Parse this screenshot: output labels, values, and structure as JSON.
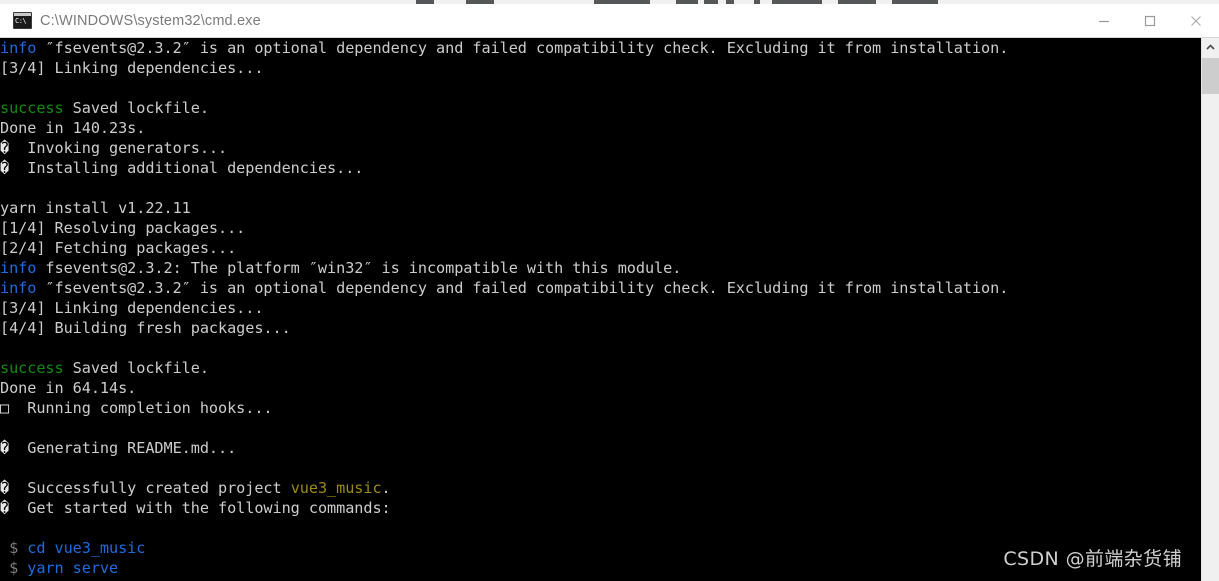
{
  "window": {
    "title": "C:\\WINDOWS\\system32\\cmd.exe",
    "icon_text": "C:\\",
    "controls": {
      "minimize": "Minimize",
      "maximize": "Maximize",
      "close": "Close"
    }
  },
  "watermark": {
    "text": "CSDN @前端杂货铺"
  },
  "scrollbar": {
    "up_arrow": "scroll-up",
    "thumb": "scroll-thumb"
  },
  "colors": {
    "background": "#000000",
    "default_text": "#cccccc",
    "info": "#1d6be0",
    "success": "#108b10",
    "project_name": "#9c8a12",
    "command": "#1d6be0",
    "prompt": "#7c7c7c",
    "titlebar_bg": "#ffffff",
    "titlebar_text": "#7b7b7b",
    "scrollbar_track": "#f0f0f0",
    "scrollbar_thumb": "#cdcdcd"
  },
  "console": {
    "lines": [
      [
        {
          "t": "info",
          "c": "info"
        },
        {
          "t": " ″fsevents@2.3.2″ is an optional dependency and failed compatibility check. Excluding it from installation.",
          "c": "default"
        }
      ],
      [
        {
          "t": "[3/4] Linking dependencies...",
          "c": "default"
        }
      ],
      [],
      [
        {
          "t": "success",
          "c": "success"
        },
        {
          "t": " Saved lockfile.",
          "c": "default"
        }
      ],
      [
        {
          "t": "Done in 140.23s.",
          "c": "default"
        }
      ],
      [
        {
          "t": "�",
          "c": "rep"
        },
        {
          "t": "  Invoking generators...",
          "c": "default"
        }
      ],
      [
        {
          "t": "�",
          "c": "rep"
        },
        {
          "t": "  Installing additional dependencies...",
          "c": "default"
        }
      ],
      [],
      [
        {
          "t": "yarn install v1.22.11",
          "c": "default"
        }
      ],
      [
        {
          "t": "[1/4] Resolving packages...",
          "c": "default"
        }
      ],
      [
        {
          "t": "[2/4] Fetching packages...",
          "c": "default"
        }
      ],
      [
        {
          "t": "info",
          "c": "info"
        },
        {
          "t": " fsevents@2.3.2: The platform ″win32″ is incompatible with this module.",
          "c": "default"
        }
      ],
      [
        {
          "t": "info",
          "c": "info"
        },
        {
          "t": " ″fsevents@2.3.2″ is an optional dependency and failed compatibility check. Excluding it from installation.",
          "c": "default"
        }
      ],
      [
        {
          "t": "[3/4] Linking dependencies...",
          "c": "default"
        }
      ],
      [
        {
          "t": "[4/4] Building fresh packages...",
          "c": "default"
        }
      ],
      [],
      [
        {
          "t": "success",
          "c": "success"
        },
        {
          "t": " Saved lockfile.",
          "c": "default"
        }
      ],
      [
        {
          "t": "Done in 64.14s.",
          "c": "default"
        }
      ],
      [
        {
          "t": "□",
          "c": "rep"
        },
        {
          "t": "  Running completion hooks...",
          "c": "default"
        }
      ],
      [],
      [
        {
          "t": "�",
          "c": "rep"
        },
        {
          "t": "  Generating README.md...",
          "c": "default"
        }
      ],
      [],
      [
        {
          "t": "�",
          "c": "rep"
        },
        {
          "t": "  Successfully created project ",
          "c": "default"
        },
        {
          "t": "vue3_music",
          "c": "yellow"
        },
        {
          "t": ".",
          "c": "default"
        }
      ],
      [
        {
          "t": "�",
          "c": "rep"
        },
        {
          "t": "  Get started with the following commands:",
          "c": "default"
        }
      ],
      [],
      [
        {
          "t": " $ ",
          "c": "dim"
        },
        {
          "t": "cd vue3_music",
          "c": "cmd"
        }
      ],
      [
        {
          "t": " $ ",
          "c": "dim"
        },
        {
          "t": "yarn serve",
          "c": "cmd"
        }
      ]
    ]
  }
}
